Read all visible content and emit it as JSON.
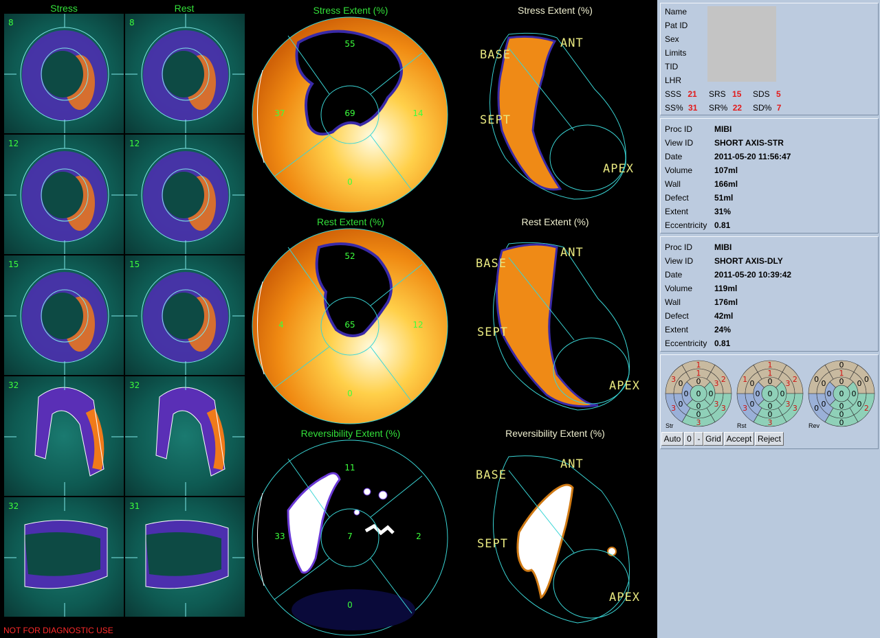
{
  "columns": {
    "stress": "Stress",
    "rest": "Rest"
  },
  "slices": {
    "stress": [
      "8",
      "12",
      "15",
      "32",
      "32"
    ],
    "rest": [
      "8",
      "12",
      "15",
      "32",
      "31"
    ]
  },
  "polar_maps": [
    {
      "title": "Stress Extent (%)",
      "top": "55",
      "left": "37",
      "center": "69",
      "right": "14",
      "bottom": "0"
    },
    {
      "title": "Rest Extent (%)",
      "top": "52",
      "left": "4",
      "center": "65",
      "right": "12",
      "bottom": "0"
    },
    {
      "title": "Reversibility Extent (%)",
      "top": "11",
      "left": "33",
      "center": "7",
      "right": "2",
      "bottom": "0"
    }
  ],
  "three_d": [
    {
      "title": "Stress Extent (%)"
    },
    {
      "title": "Rest Extent (%)"
    },
    {
      "title": "Reversibility Extent (%)"
    }
  ],
  "orientation_labels": {
    "base": "BASE",
    "ant": "ANT",
    "sept": "SEPT",
    "apex": "APEX"
  },
  "warning": "NOT FOR DIAGNOSTIC USE",
  "patient": {
    "labels": [
      "Name",
      "Pat ID",
      "Sex",
      "Limits",
      "TID",
      "LHR"
    ],
    "scores": [
      {
        "label": "SSS",
        "value": "21"
      },
      {
        "label": "SRS",
        "value": "15"
      },
      {
        "label": "SDS",
        "value": "5"
      },
      {
        "label": "SS%",
        "value": "31"
      },
      {
        "label": "SR%",
        "value": "22"
      },
      {
        "label": "SD%",
        "value": "7"
      }
    ]
  },
  "proc_stress": [
    {
      "label": "Proc ID",
      "value": "MIBI"
    },
    {
      "label": "View ID",
      "value": "SHORT AXIS-STR"
    },
    {
      "label": "Date",
      "value": "2011-05-20 11:56:47"
    },
    {
      "label": "Volume",
      "value": "107ml"
    },
    {
      "label": "Wall",
      "value": "166ml"
    },
    {
      "label": "Defect",
      "value": "51ml"
    },
    {
      "label": "Extent",
      "value": "31%"
    },
    {
      "label": "Eccentricity",
      "value": "0.81"
    }
  ],
  "proc_rest": [
    {
      "label": "Proc ID",
      "value": "MIBI"
    },
    {
      "label": "View ID",
      "value": "SHORT AXIS-DLY"
    },
    {
      "label": "Date",
      "value": "2011-05-20 10:39:42"
    },
    {
      "label": "Volume",
      "value": "119ml"
    },
    {
      "label": "Wall",
      "value": "176ml"
    },
    {
      "label": "Defect",
      "value": "42ml"
    },
    {
      "label": "Extent",
      "value": "24%"
    },
    {
      "label": "Eccentricity",
      "value": "0.81"
    }
  ],
  "bullseyes": [
    {
      "label": "Str",
      "segments": [
        "1",
        "2",
        "3",
        "3",
        "3",
        "3",
        "1",
        "3",
        "3",
        "0",
        "0",
        "0",
        "0",
        "0",
        "0",
        "0",
        "0"
      ]
    },
    {
      "label": "Rst",
      "segments": [
        "1",
        "2",
        "3",
        "3",
        "3",
        "1",
        "1",
        "3",
        "3",
        "0",
        "0",
        "0",
        "0",
        "0",
        "0",
        "0",
        "0"
      ]
    },
    {
      "label": "Rev",
      "segments": [
        "0",
        "0",
        "2",
        "0",
        "0",
        "0",
        "1",
        "0",
        "0",
        "0",
        "0",
        "0",
        "0",
        "0",
        "0",
        "0",
        "0"
      ]
    }
  ],
  "buttons": {
    "auto": "Auto",
    "zero": "0",
    "dash": "-",
    "grid": "Grid",
    "accept": "Accept",
    "reject": "Reject"
  },
  "colors": {
    "panel": "#b9c9dd",
    "score_red": "#e21a1a",
    "slice_green": "#3cff3c",
    "orientation": "#e8e880"
  }
}
